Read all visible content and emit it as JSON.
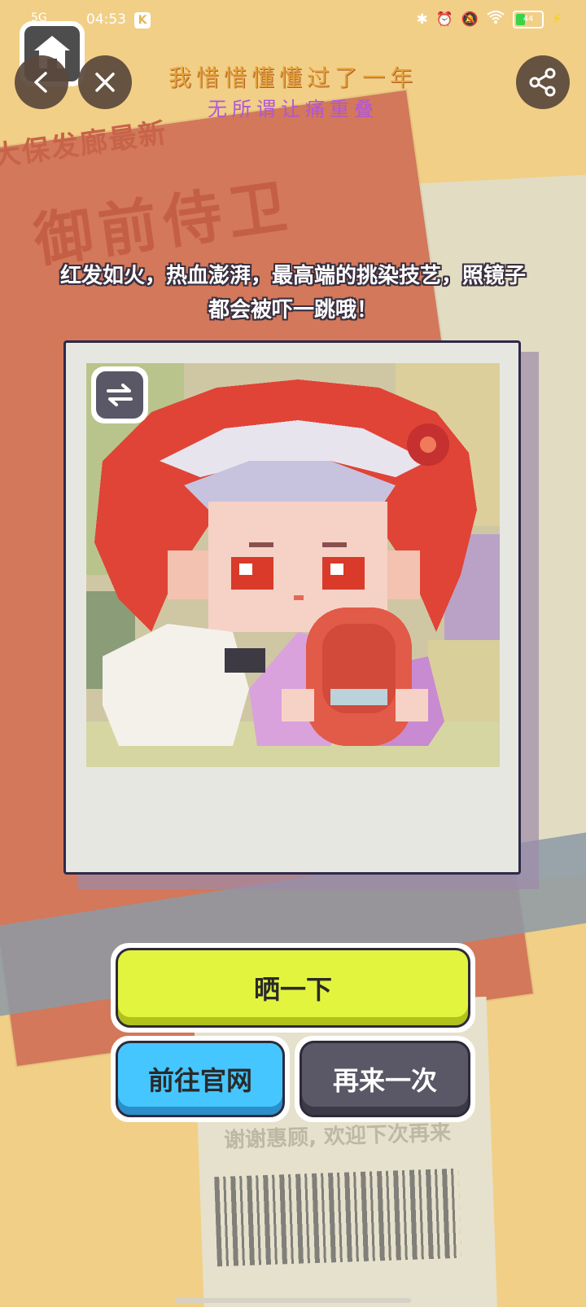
{
  "status_bar": {
    "time": "04:53",
    "network": "5G",
    "battery_level": 44,
    "battery_text": "44",
    "icons": [
      "bluetooth-icon",
      "alarm-icon",
      "mute-icon",
      "wifi-icon",
      "battery-icon",
      "charging-icon"
    ]
  },
  "header": {
    "title_line_1": "我惜惜懂懂过了一年",
    "title_line_2": "无所谓让痛重叠"
  },
  "background": {
    "poster_small_text": "大保发廊最新",
    "poster_big_text": "御前侍卫",
    "ticket_footer": "谢谢惠顾, 欢迎下次再来"
  },
  "main": {
    "description": "红发如火，热血澎湃，最高端的挑染技艺，照镜子都会被吓一跳哦！"
  },
  "buttons": {
    "share_label": "晒一下",
    "official_site_label": "前往官网",
    "retry_label": "再来一次"
  },
  "colors": {
    "share_button": "#e3f43f",
    "site_button": "#45c6ff",
    "retry_button": "#5a5766",
    "background": "#f1cf86",
    "poster": "#d3785a"
  }
}
